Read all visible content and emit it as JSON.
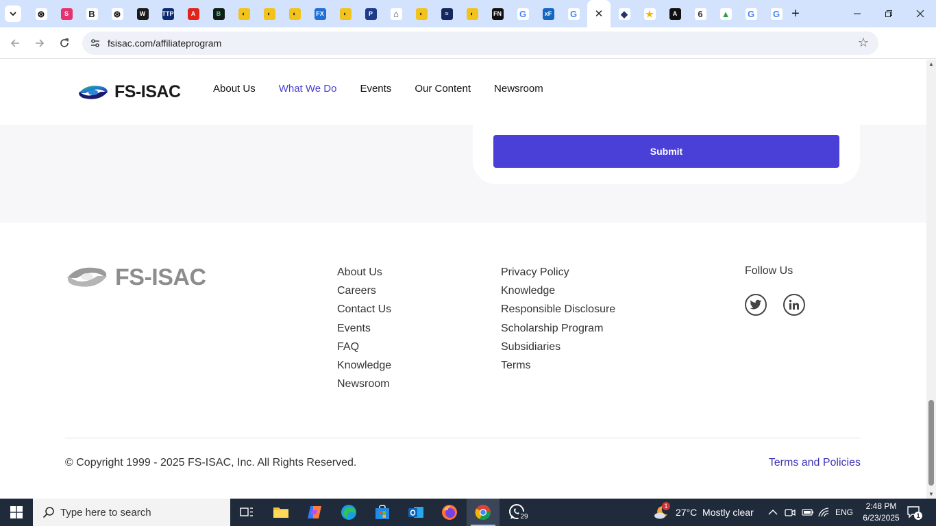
{
  "browser": {
    "tabs": [
      {
        "icon": "openai-icon",
        "glyph": "⊛",
        "bg": "#ffffff",
        "fg": "#111111"
      },
      {
        "icon": "s-logo-icon",
        "glyph": "S",
        "bg": "#e8326f",
        "fg": "#ffffff"
      },
      {
        "icon": "b-logo-icon",
        "glyph": "B",
        "bg": "#ffffff",
        "fg": "#222222"
      },
      {
        "icon": "openai-icon",
        "glyph": "⊛",
        "bg": "#ffffff",
        "fg": "#111111"
      },
      {
        "icon": "w-logo-icon",
        "glyph": "W",
        "bg": "#1a1a1a",
        "fg": "#ffffff"
      },
      {
        "icon": "ttp-icon",
        "glyph": "TTP",
        "bg": "#0b2a6f",
        "fg": "#ffffff"
      },
      {
        "icon": "acrobat-icon",
        "glyph": "A",
        "bg": "#e2231a",
        "fg": "#ffffff"
      },
      {
        "icon": "green-logo-icon",
        "glyph": "B",
        "bg": "#0f1d16",
        "fg": "#33e08a"
      },
      {
        "icon": "yellow-circle-icon",
        "glyph": "◐",
        "bg": "#f2c31a",
        "fg": "#111111"
      },
      {
        "icon": "yellow-circle-icon",
        "glyph": "◐",
        "bg": "#f2c31a",
        "fg": "#111111"
      },
      {
        "icon": "yellow-circle-icon",
        "glyph": "◐",
        "bg": "#f2c31a",
        "fg": "#111111"
      },
      {
        "icon": "fx-icon",
        "glyph": "FX",
        "bg": "#1f6fd6",
        "fg": "#ffffff"
      },
      {
        "icon": "yellow-circle-icon",
        "glyph": "◐",
        "bg": "#f2c31a",
        "fg": "#111111"
      },
      {
        "icon": "p-logo-icon",
        "glyph": "P",
        "bg": "#1e3a8a",
        "fg": "#ffffff"
      },
      {
        "icon": "chart-icon",
        "glyph": "⌂",
        "bg": "#ffffff",
        "fg": "#333333"
      },
      {
        "icon": "yellow-circle-icon",
        "glyph": "◐",
        "bg": "#f2c31a",
        "fg": "#111111"
      },
      {
        "icon": "wave-icon",
        "glyph": "≈",
        "bg": "#14285e",
        "fg": "#ffffff"
      },
      {
        "icon": "yellow-circle-icon",
        "glyph": "◐",
        "bg": "#f2c31a",
        "fg": "#111111"
      },
      {
        "icon": "fn-icon",
        "glyph": "FN",
        "bg": "#111111",
        "fg": "#ffffff"
      },
      {
        "icon": "google-icon",
        "glyph": "G",
        "bg": "#ffffff",
        "fg": "#4285f4"
      },
      {
        "icon": "xf-icon",
        "glyph": "xF",
        "bg": "#1566c0",
        "fg": "#ffffff"
      },
      {
        "icon": "google-icon",
        "glyph": "G",
        "bg": "#ffffff",
        "fg": "#4285f4"
      },
      {
        "icon": "active",
        "glyph": "✕",
        "bg": "#ffffff",
        "fg": "#1f1f1f"
      },
      {
        "icon": "spy-icon",
        "glyph": "◆",
        "bg": "#ffffff",
        "fg": "#24356b"
      },
      {
        "icon": "star-icon",
        "glyph": "★",
        "bg": "#ffffff",
        "fg": "#f2b705"
      },
      {
        "icon": "a-logo-icon",
        "glyph": "A",
        "bg": "#111111",
        "fg": "#ffffff"
      },
      {
        "icon": "six-icon",
        "glyph": "6",
        "bg": "#ffffff",
        "fg": "#333333"
      },
      {
        "icon": "drive-icon",
        "glyph": "▲",
        "bg": "#ffffff",
        "fg": "#2f9e44"
      },
      {
        "icon": "google-icon",
        "glyph": "G",
        "bg": "#ffffff",
        "fg": "#4285f4"
      },
      {
        "icon": "google-icon",
        "glyph": "G",
        "bg": "#ffffff",
        "fg": "#4285f4"
      }
    ],
    "url": "fsisac.com/affiliateprogram"
  },
  "site": {
    "brand": "FS-ISAC",
    "nav": [
      "About Us",
      "What We Do",
      "Events",
      "Our Content",
      "Newsroom"
    ],
    "active_nav": "What We Do",
    "submit_label": "Submit",
    "accent": "#4a3fd6"
  },
  "footer": {
    "brand": "FS-ISAC",
    "col1": [
      "About Us",
      "Careers",
      "Contact Us",
      "Events",
      "FAQ",
      "Knowledge",
      "Newsroom"
    ],
    "col2": [
      "Privacy Policy",
      "Knowledge",
      "Responsible Disclosure",
      "Scholarship Program",
      "Subsidiaries",
      "Terms"
    ],
    "follow_label": "Follow Us",
    "social": [
      "twitter-icon",
      "linkedin-icon"
    ],
    "copyright": "© Copyright 1999 - 2025 FS-ISAC, Inc. All Rights Reserved.",
    "terms_link": "Terms and Policies"
  },
  "taskbar": {
    "search_placeholder": "Type here to search",
    "whatsapp_badge": "29",
    "weather_badge": "1",
    "weather": "27°C  Mostly clear",
    "language": "ENG",
    "time": "2:48 PM",
    "date": "6/23/2025",
    "notification_count": "1"
  }
}
